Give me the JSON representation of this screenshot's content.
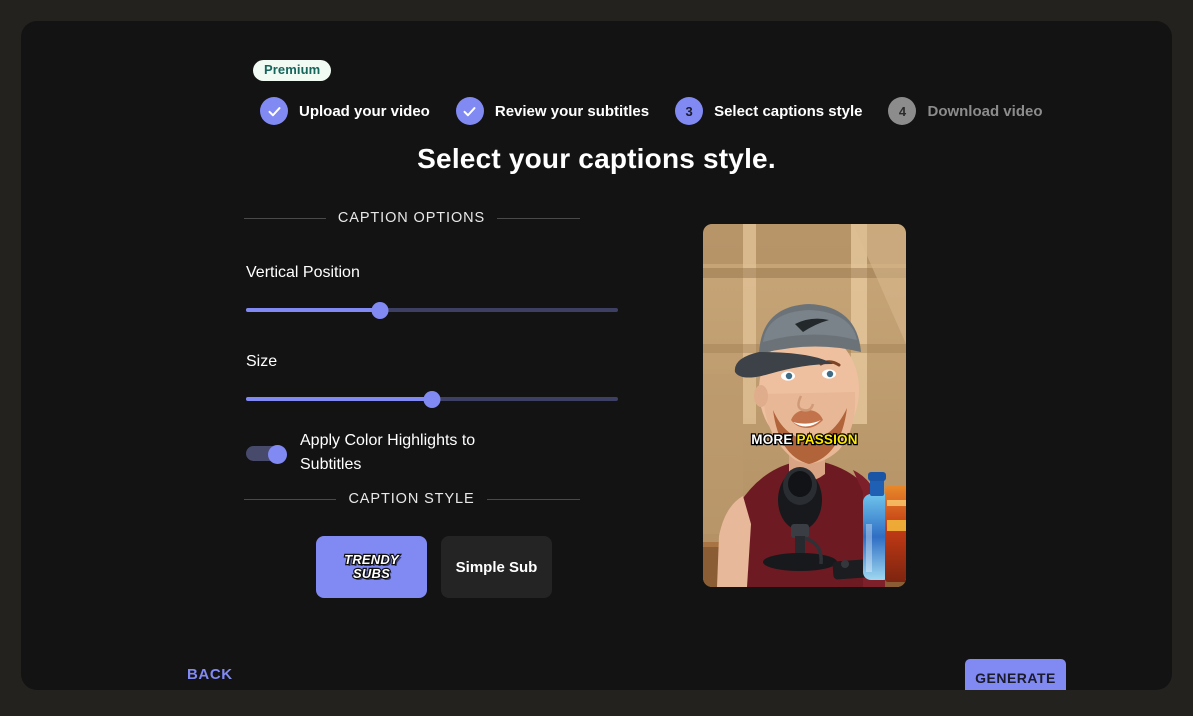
{
  "badge": {
    "label": "Premium"
  },
  "stepper": {
    "steps": [
      {
        "num": "1",
        "label": "Upload your video",
        "state": "done"
      },
      {
        "num": "2",
        "label": "Review your subtitles",
        "state": "done"
      },
      {
        "num": "3",
        "label": "Select captions style",
        "state": "active"
      },
      {
        "num": "4",
        "label": "Download video",
        "state": "todo"
      }
    ]
  },
  "page": {
    "title": "Select your captions style."
  },
  "options": {
    "section_heading": "CAPTION OPTIONS",
    "vertical_position": {
      "label": "Vertical Position",
      "value": 36
    },
    "size": {
      "label": "Size",
      "value": 50
    },
    "highlights_toggle": {
      "label": "Apply Color Highlights to Subtitles",
      "on": true
    }
  },
  "caption_style": {
    "section_heading": "CAPTION STYLE",
    "options": [
      {
        "label": "TRENDY SUBS",
        "line1": "TRENDY",
        "line2": "SUBS",
        "selected": true
      },
      {
        "label": "Simple Sub",
        "selected": false
      }
    ]
  },
  "preview": {
    "caption_word_plain": "MORE",
    "caption_word_highlight": "PASSION"
  },
  "footer": {
    "back_label": "BACK",
    "generate_label": "GENERATE"
  },
  "colors": {
    "accent": "#8189f3",
    "page_bg": "#24221f",
    "card_bg": "#131313",
    "highlight_yellow": "#ffe900",
    "badge_bg": "#f1faf3",
    "badge_text": "#16655a"
  }
}
